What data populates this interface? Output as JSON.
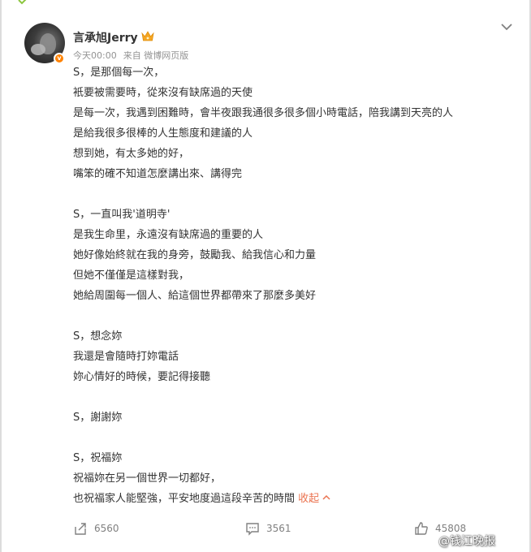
{
  "post": {
    "author": "言承旭Jerry",
    "timestamp": "今天00:00",
    "source": "来自 微博网页版",
    "lines": [
      "S，是那個每一次，",
      "衹要被需要時，從來沒有缺席過的天使",
      "是每一次，我遇到困難時，會半夜跟我通很多很多個小時電話，陪我講到天亮的人",
      "是給我很多很棒的人生態度和建議的人",
      "想到她，有太多她的好，",
      "嘴笨的確不知道怎麼講出來、講得完",
      "",
      "S，一直叫我'道明寺'",
      "是我生命里，永遠沒有缺席過的重要的人",
      "她好像始終就在我的身旁，鼓勵我、給我信心和力量",
      "但她不僅僅是這樣對我，",
      "她給周圍每一個人、給這個世界都帶來了那麼多美好",
      "",
      "S，想念妳",
      "我還是會隨時打妳電話",
      "妳心情好的時候，要記得接聽",
      "",
      "S，謝謝妳",
      "",
      "S，祝福妳",
      "祝福妳在另一個世界一切都好，",
      "也祝福家人能堅強，平安地度過這段辛苦的時間"
    ],
    "collapse_label": "收起"
  },
  "actions": {
    "repost_count": "6560",
    "comment_count": "3561",
    "like_count": "45808"
  },
  "watermark": "@钱江晚报",
  "icons": {
    "dropdown": "chevron-down-icon",
    "verified": "verified-badge-icon",
    "crown": "crown-icon",
    "repost": "repost-icon",
    "comment": "comment-icon",
    "like": "like-icon"
  },
  "colors": {
    "accent": "#eb7350",
    "verified": "#ff8200",
    "text": "#333333",
    "muted": "#939393"
  }
}
